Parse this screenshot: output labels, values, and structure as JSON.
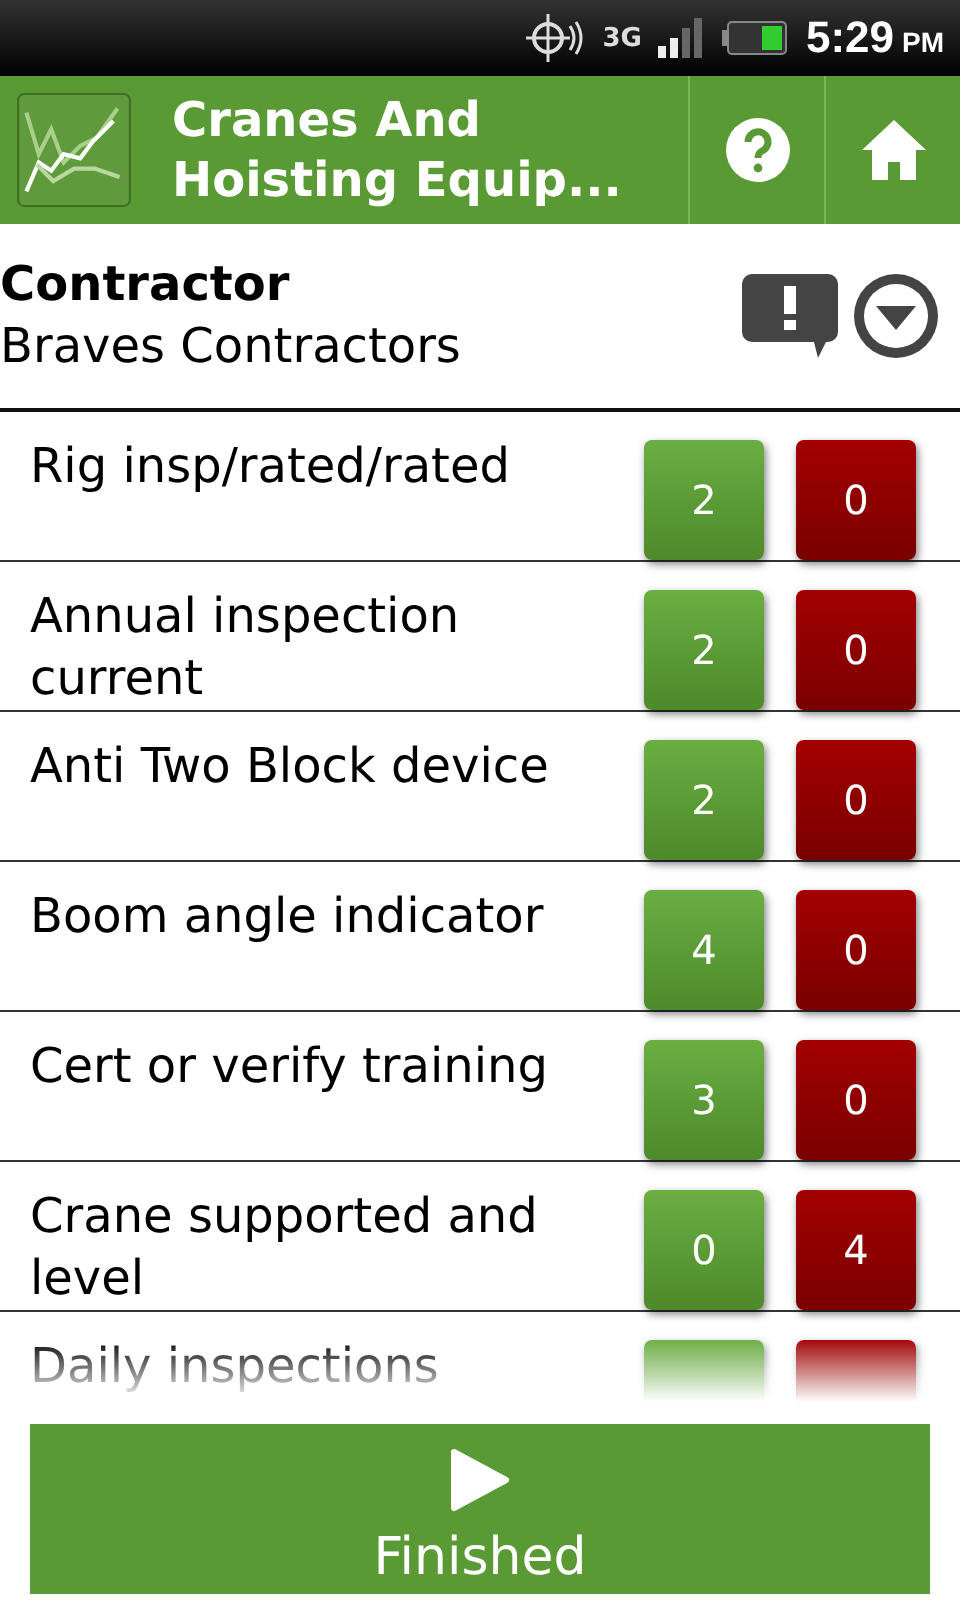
{
  "status_bar": {
    "network": "3G",
    "time": "5:29",
    "ampm": "PM"
  },
  "title_bar": {
    "title": "Cranes And Hoisting Equip..."
  },
  "header": {
    "label": "Contractor",
    "value": "Braves Contractors"
  },
  "items": [
    {
      "label": "Rig insp/rated/rated",
      "pass": "2",
      "fail": "0"
    },
    {
      "label": "Annual inspection current",
      "pass": "2",
      "fail": "0"
    },
    {
      "label": "Anti Two Block device",
      "pass": "2",
      "fail": "0"
    },
    {
      "label": "Boom angle indicator",
      "pass": "4",
      "fail": "0"
    },
    {
      "label": "Cert or verify training",
      "pass": "3",
      "fail": "0"
    },
    {
      "label": "Crane supported and level",
      "pass": "0",
      "fail": "4"
    },
    {
      "label": "Daily inspections"
    }
  ],
  "finish_button": {
    "label": "Finished"
  }
}
